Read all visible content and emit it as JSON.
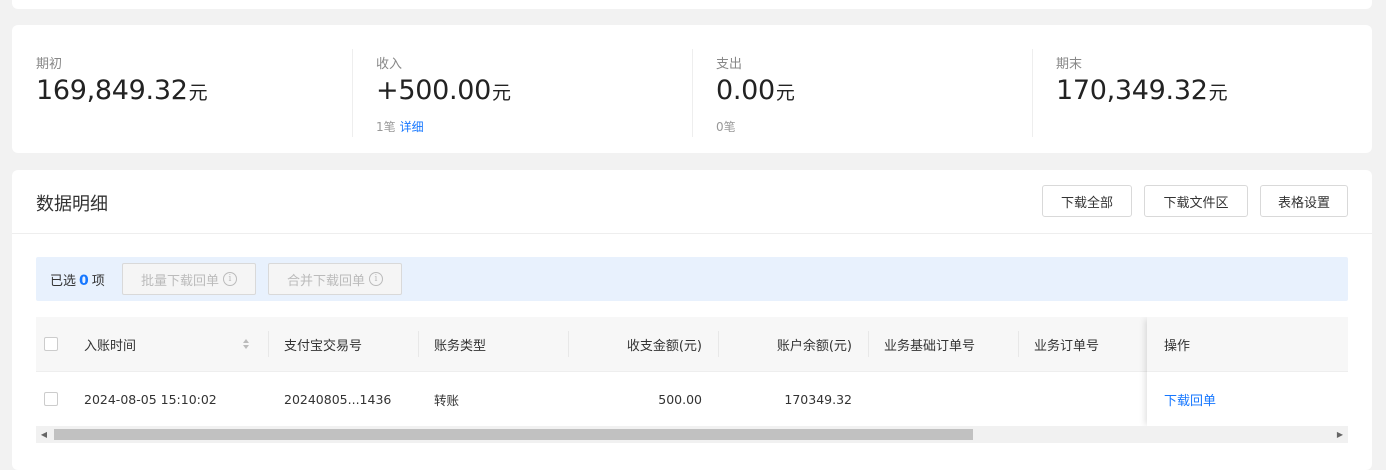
{
  "summary": {
    "opening": {
      "label": "期初",
      "amount": "169,849.32",
      "unit": "元"
    },
    "income": {
      "label": "收入",
      "amount": "+500.00",
      "unit": "元",
      "count": "1笔",
      "detail_link": "详细"
    },
    "expense": {
      "label": "支出",
      "amount": "0.00",
      "unit": "元",
      "count": "0笔"
    },
    "closing": {
      "label": "期末",
      "amount": "170,349.32",
      "unit": "元"
    }
  },
  "detail": {
    "title": "数据明细",
    "buttons": {
      "download_all": "下载全部",
      "download_files": "下载文件区",
      "table_settings": "表格设置"
    },
    "selection": {
      "prefix": "已选",
      "count": "0",
      "suffix": "项",
      "batch_download": "批量下载回单",
      "merge_download": "合并下载回单"
    },
    "columns": {
      "time": "入账时间",
      "alipay_no": "支付宝交易号",
      "type": "账务类型",
      "amount": "收支金额(元)",
      "balance": "账户余额(元)",
      "base_order": "业务基础订单号",
      "order": "业务订单号",
      "action": "操作"
    },
    "rows": [
      {
        "time": "2024-08-05 15:10:02",
        "alipay_no": "20240805...1436",
        "type": "转账",
        "amount": "500.00",
        "balance": "170349.32",
        "base_order": "",
        "order": "",
        "action": "下载回单"
      }
    ]
  },
  "icons": {
    "info": "info-circle-icon",
    "sort": "sort-icon",
    "scroll_left": "scroll-left-arrow-icon",
    "scroll_right": "scroll-right-arrow-icon"
  },
  "colors": {
    "accent": "#1677ff",
    "selection_bg": "#e8f1fd"
  },
  "scroll": {
    "thumb_fraction": 0.72
  }
}
